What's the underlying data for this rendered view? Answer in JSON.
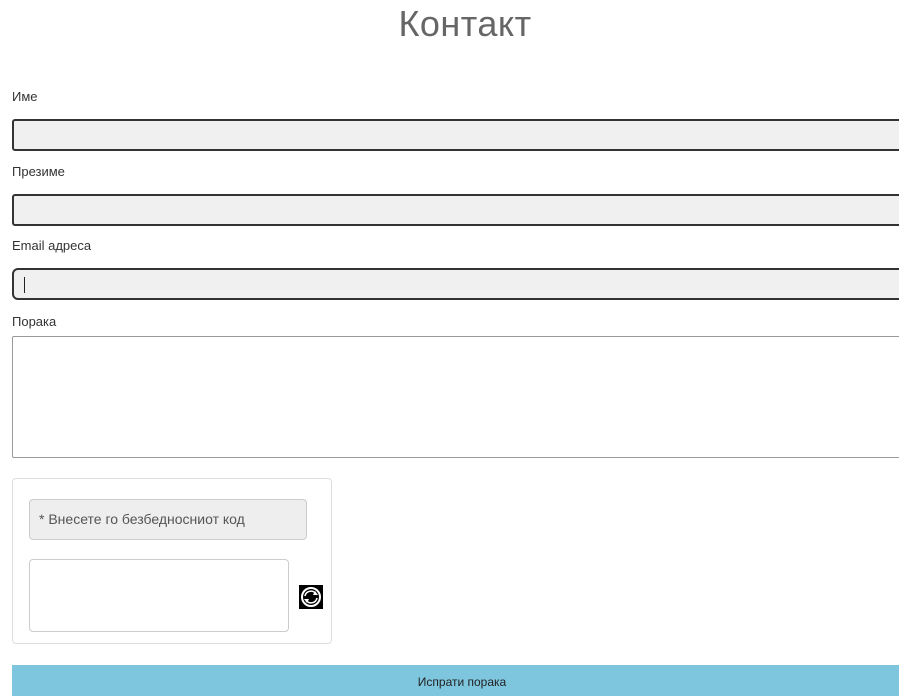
{
  "page": {
    "title": "Контакт"
  },
  "form": {
    "first_name": {
      "label": "Име",
      "value": ""
    },
    "last_name": {
      "label": "Презиме",
      "value": ""
    },
    "email": {
      "label": "Email адреса",
      "value": ""
    },
    "message": {
      "label": "Порака",
      "value": ""
    }
  },
  "captcha": {
    "prompt": "* Внесете го безбедносниот код",
    "value": "",
    "refresh_icon": "refresh-icon"
  },
  "submit": {
    "label": "Испрати порака",
    "color": "#7ec6de"
  }
}
